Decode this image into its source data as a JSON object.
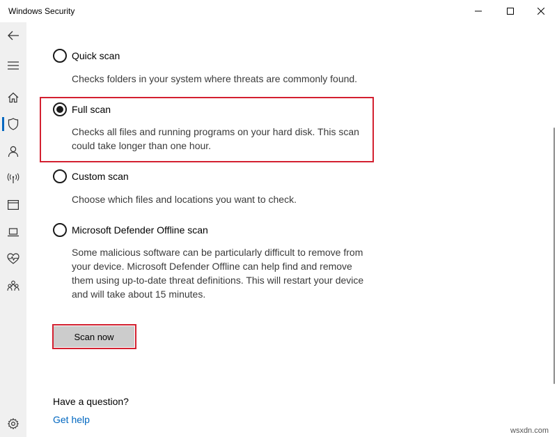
{
  "window": {
    "title": "Windows Security",
    "controls": [
      "minimize-icon",
      "maximize-icon",
      "close-icon"
    ]
  },
  "rail": {
    "items": [
      {
        "name": "back",
        "icon": "back-arrow-icon"
      },
      {
        "name": "menu",
        "icon": "hamburger-menu-icon"
      },
      {
        "name": "home",
        "icon": "home-icon"
      },
      {
        "name": "virus-threat-protection",
        "icon": "shield-icon",
        "active": true
      },
      {
        "name": "account-protection",
        "icon": "person-icon"
      },
      {
        "name": "firewall-network",
        "icon": "antenna-icon"
      },
      {
        "name": "app-browser-control",
        "icon": "browser-window-icon"
      },
      {
        "name": "device-security",
        "icon": "laptop-icon"
      },
      {
        "name": "device-performance",
        "icon": "heart-pulse-icon"
      },
      {
        "name": "family-options",
        "icon": "family-icon"
      },
      {
        "name": "settings",
        "icon": "gear-icon"
      }
    ]
  },
  "scan_options": [
    {
      "label": "Quick scan",
      "description": "Checks folders in your system where threats are commonly found.",
      "selected": false
    },
    {
      "label": "Full scan",
      "description_lines": [
        "Checks all files and running programs on your hard disk. This scan",
        "could take longer than one hour."
      ],
      "selected": true
    },
    {
      "label": "Custom scan",
      "description": "Choose which files and locations you want to check.",
      "selected": false
    },
    {
      "label": "Microsoft Defender Offline scan",
      "description_lines": [
        "Some malicious software can be particularly difficult to remove from",
        "your device. Microsoft Defender Offline can help find and remove",
        "them using up-to-date threat definitions. This will restart your device",
        "and will take about 15 minutes."
      ],
      "selected": false
    }
  ],
  "actions": {
    "scan_now": "Scan now"
  },
  "help": {
    "question": "Have a question?",
    "link": "Get help"
  },
  "watermark": "wsxdn.com",
  "colors": {
    "accent": "#0067c0",
    "highlight_box": "#d32030",
    "button_bg": "#cccccc",
    "rail_bg": "#f0f0f0"
  }
}
